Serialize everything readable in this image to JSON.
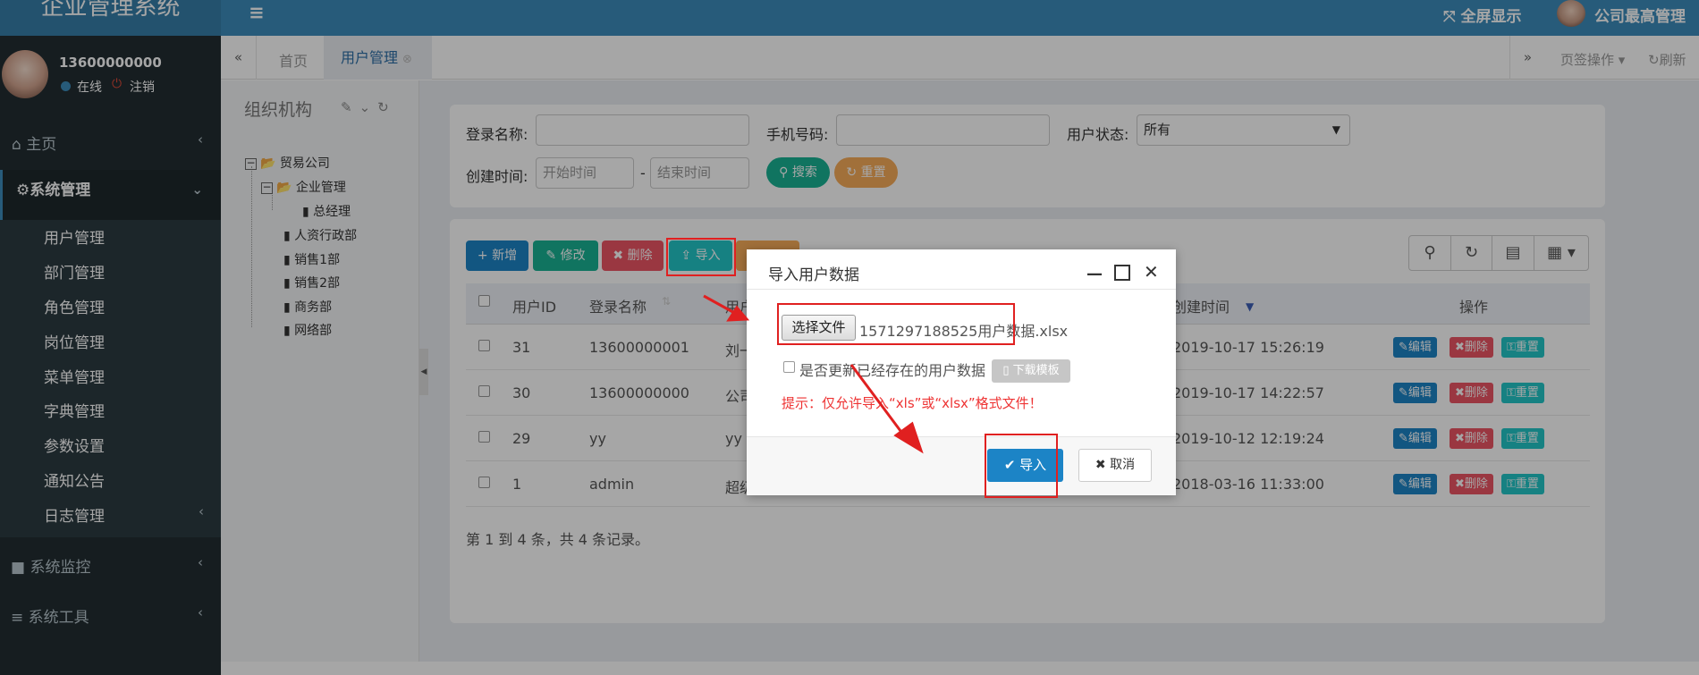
{
  "app": {
    "title": "企业管理系统",
    "fullscreen": "全屏显示",
    "user_name": "公司最高管理"
  },
  "sidebar": {
    "phone": "13600000000",
    "online": "在线",
    "logout": "注销",
    "home": "主页",
    "system_mgmt": "系统管理",
    "sub_items": [
      "用户管理",
      "部门管理",
      "角色管理",
      "岗位管理",
      "菜单管理",
      "字典管理",
      "参数设置",
      "通知公告",
      "日志管理"
    ],
    "monitor": "系统监控",
    "tools": "系统工具"
  },
  "tabs": {
    "home": "首页",
    "active": "用户管理",
    "ops": "页签操作",
    "refresh": "刷新"
  },
  "org": {
    "title": "组织机构",
    "tree": [
      {
        "label": "贸易公司"
      },
      {
        "label": "企业管理"
      },
      {
        "label": "总经理"
      },
      {
        "label": "人资行政部"
      },
      {
        "label": "销售1部"
      },
      {
        "label": "销售2部"
      },
      {
        "label": "商务部"
      },
      {
        "label": "网络部"
      }
    ]
  },
  "search": {
    "login_name_label": "登录名称:",
    "phone_label": "手机号码:",
    "status_label": "用户状态:",
    "status_value": "所有",
    "created_label": "创建时间:",
    "start_placeholder": "开始时间",
    "end_placeholder": "结束时间",
    "search_btn": "搜索",
    "reset_btn": "重置"
  },
  "toolbar": {
    "add": "新增",
    "edit": "修改",
    "delete": "删除",
    "import": "导入"
  },
  "table": {
    "headers": {
      "id": "用户ID",
      "login": "登录名称",
      "user": "用户",
      "created": "创建时间",
      "ops": "操作"
    },
    "rows": [
      {
        "id": "31",
        "login": "13600000001",
        "user": "刘一",
        "created": "2019-10-17 15:26:19"
      },
      {
        "id": "30",
        "login": "13600000000",
        "user": "公司",
        "created": "2019-10-17 14:22:57"
      },
      {
        "id": "29",
        "login": "yy",
        "user": "yy",
        "created": "2019-10-12 12:19:24"
      },
      {
        "id": "1",
        "login": "admin",
        "user": "超级",
        "created": "2018-03-16 11:33:00"
      }
    ],
    "row_edit": "编辑",
    "row_delete": "删除",
    "row_reset": "重置",
    "footer": "第 1 到 4 条，共 4 条记录。"
  },
  "modal": {
    "title": "导入用户数据",
    "choose_file": "选择文件",
    "file_name": "1571297188525用户数据.xlsx",
    "update_existing": "是否更新已经存在的用户数据",
    "download_template": "下载模板",
    "hint": "提示：仅允许导入“xls”或“xlsx”格式文件！",
    "import_btn": "导入",
    "cancel_btn": "取消"
  },
  "colors": {
    "header": "#3c8dbc",
    "sidebar": "#222d32",
    "primary": "#1c84c6",
    "success": "#1ab394",
    "warning": "#f8ac59",
    "danger": "#ed5565",
    "info": "#23c6c8"
  }
}
